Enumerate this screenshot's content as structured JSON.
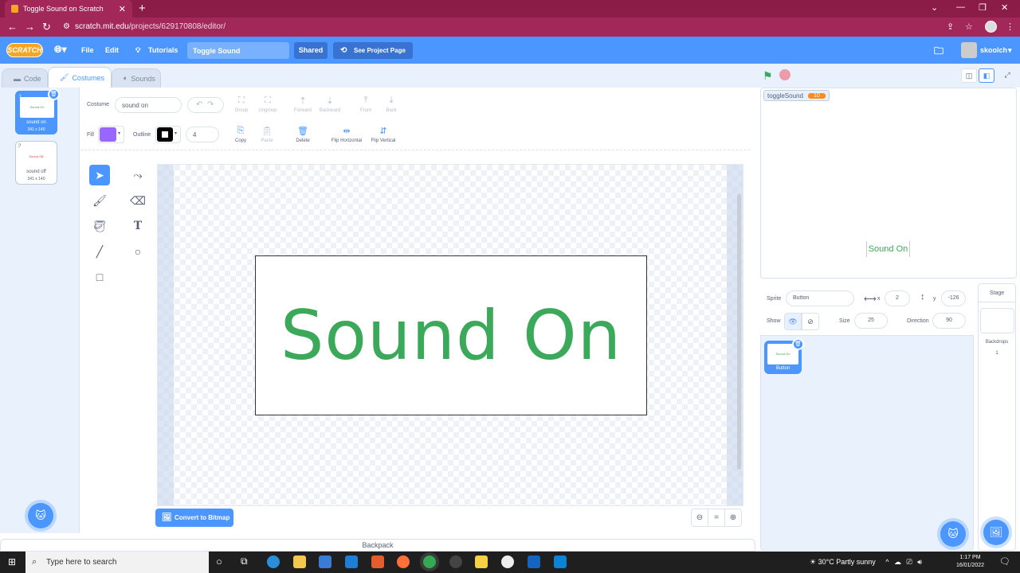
{
  "browser": {
    "tab_title": "Toggle Sound on Scratch",
    "url_host": "scratch.mit.edu",
    "url_path": "/projects/629170808/editor/"
  },
  "menubar": {
    "logo": "SCRATCH",
    "file": "File",
    "edit": "Edit",
    "tutorials": "Tutorials",
    "project_title": "Toggle Sound",
    "shared": "Shared",
    "see_project_page": "See Project Page",
    "username": "skoolch"
  },
  "tabs": {
    "code": "Code",
    "costumes": "Costumes",
    "sounds": "Sounds"
  },
  "costumes": [
    {
      "num": "1",
      "name": "sound on",
      "size": "341 x 140",
      "preview": "Sound On"
    },
    {
      "num": "2",
      "name": "sound off",
      "size": "341 x 140",
      "preview": "Sound Off"
    }
  ],
  "editor": {
    "costume_label": "Costume",
    "costume_name": "sound on",
    "fill_label": "Fill",
    "outline_label": "Outline",
    "outline_width": "4",
    "fill_color": "#9966ff",
    "group": "Group",
    "ungroup": "Ungroup",
    "forward": "Forward",
    "backward": "Backward",
    "front": "Front",
    "back": "Back",
    "copy": "Copy",
    "paste": "Paste",
    "delete": "Delete",
    "flip_h": "Flip Horizontal",
    "flip_v": "Flip Vertical",
    "canvas_text": "Sound On",
    "convert": "Convert to Bitmap",
    "backpack": "Backpack"
  },
  "stage": {
    "var_name": "toggleSound",
    "var_value": "10",
    "sprite_text": "Sound On"
  },
  "sprite": {
    "sprite_label": "Sprite",
    "name": "Button",
    "x_label": "x",
    "x": "2",
    "y_label": "y",
    "y": "-126",
    "show_label": "Show",
    "size_label": "Size",
    "size": "25",
    "direction_label": "Direction",
    "direction": "90",
    "thumb_name": "Button",
    "thumb_preview": "Sound On"
  },
  "stage_panel": {
    "title": "Stage",
    "backdrops_label": "Backdrops",
    "backdrops_count": "1"
  },
  "taskbar": {
    "search_placeholder": "Type here to search",
    "weather": "30°C  Partly sunny",
    "time": "1:17 PM",
    "date": "16/01/2022"
  }
}
